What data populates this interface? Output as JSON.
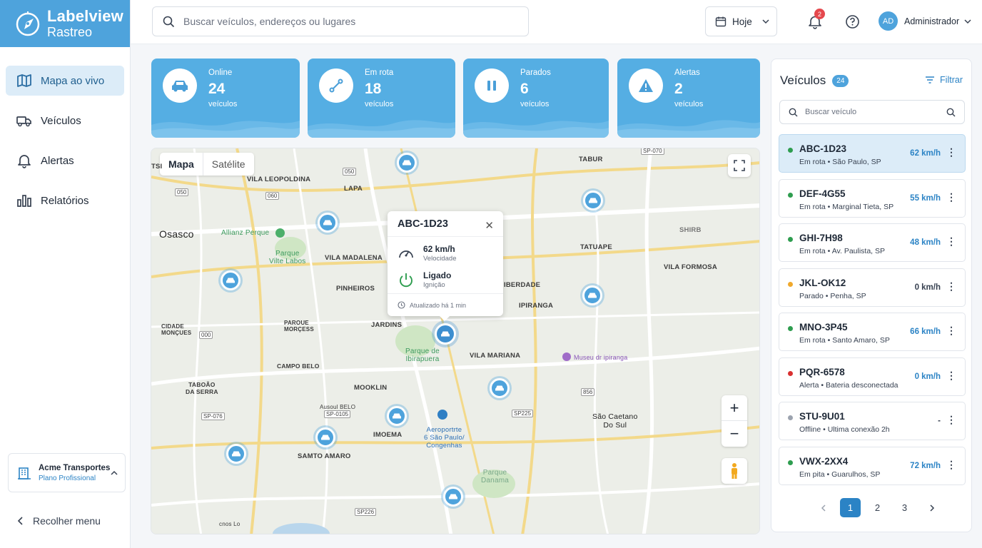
{
  "brand": {
    "line1": "Labelview",
    "line2": "Rastreo",
    "color": "#4ea3dc"
  },
  "nav": [
    {
      "label": "Mapa ao vivo",
      "icon": "map-icon"
    },
    {
      "label": "Veículos",
      "icon": "truck-icon"
    },
    {
      "label": "Alertas",
      "icon": "bell-icon"
    },
    {
      "label": "Relatórios",
      "icon": "bar-chart-icon"
    }
  ],
  "org": {
    "name": "Acme Transportes",
    "plan": "Plano Profissional"
  },
  "collapse_label": "Recolher menu",
  "topbar": {
    "search_placeholder": "Buscar veículos, endereços ou lugares",
    "date_label": "Hoje",
    "notif_count": "2",
    "user_initials": "AD",
    "user_name": "Administrador"
  },
  "stats": [
    {
      "label": "Online",
      "value": "24",
      "unit": "veículos",
      "icon": "car-icon"
    },
    {
      "label": "Em rota",
      "value": "18",
      "unit": "veículos",
      "icon": "route-icon"
    },
    {
      "label": "Parados",
      "value": "6",
      "unit": "veículos",
      "icon": "pause-icon"
    },
    {
      "label": "Alertas",
      "value": "2",
      "unit": "veículos",
      "icon": "warning-icon"
    }
  ],
  "map": {
    "tabs": [
      "Mapa",
      "Satélite"
    ],
    "labels": {
      "osasco": "Osasco",
      "vila_leopoldina": "VILA LEOPOLDINA",
      "lapa": "LAPA",
      "tabur": "TABUR",
      "allianz": "Allianz Perque",
      "parque_vilte": "Parque\nVilte Labos",
      "vila_madalena": "VILA MADALENA",
      "tatuape": "TATUAPE",
      "vila_formosa": "VILA FORMOSA",
      "pinheiros": "PINHEIROS",
      "liberdade": "IBERDADE",
      "ipiranga": "IPIRANGA",
      "cidade_moncoes": "CIDADE\nMONÇUES",
      "parque_morcess": "PAROUE\nMORÇESS",
      "jardins": "JARDINS",
      "ibirapuera": "Parque de\nIbirapuera",
      "vila_mariana": "VILA MARIANA",
      "museu": "Museu dr ipiranga",
      "campo_belo": "CAMPO BELO",
      "taboao": "TABOÃO\nDA SERRA",
      "mooklin": "MOOKLIN",
      "ausoul": "Ausoul BELO",
      "imoema": "IMOEMA",
      "aeroporto": "Aeroportrte\n6 São Paulo/\nCongenhas",
      "sao_caetano": "São Caetano\nDo Sul",
      "santo_amaro": "SAMTO AMARO",
      "parque_danama": "Parque\nDanama",
      "shirb": "SHIRB",
      "cnos": "cnos Lo",
      "tsi": "TSI"
    },
    "road_shields": [
      "SP-070",
      "050",
      "050",
      "060",
      "000",
      "856",
      "SP225",
      "SP-076",
      "SP-0105",
      "SP226"
    ],
    "popup": {
      "plate": "ABC-1D23",
      "speed": "62 km/h",
      "speed_label": "Velocidade",
      "ignition": "Ligado",
      "ignition_label": "Ignição",
      "updated": "Atualizado há 1 min"
    }
  },
  "panel": {
    "title": "Veículos",
    "count": "24",
    "filter_label": "Filtrar",
    "search_placeholder": "Buscar veículo",
    "vehicles": [
      {
        "plate": "ABC-1D23",
        "status": "Em rota",
        "location": "São Paulo, SP",
        "speed": "62 km/h",
        "dot": "#2e9d4f",
        "speed_color": "#2b83c5"
      },
      {
        "plate": "DEF-4G55",
        "status": "Em rota",
        "location": "Marginal Tieta, SP",
        "speed": "55 km/h",
        "dot": "#2e9d4f",
        "speed_color": "#2b83c5"
      },
      {
        "plate": "GHI-7H98",
        "status": "Em rota",
        "location": "Av. Paulista, SP",
        "speed": "48 km/h",
        "dot": "#2e9d4f",
        "speed_color": "#2b83c5"
      },
      {
        "plate": "JKL-OK12",
        "status": "Parado",
        "location": "Penha, SP",
        "speed": "0 km/h",
        "dot": "#f0a92c",
        "speed_color": "#374151"
      },
      {
        "plate": "MNO-3P45",
        "status": "Em rota",
        "location": "Santo Amaro, SP",
        "speed": "66 km/h",
        "dot": "#2e9d4f",
        "speed_color": "#2b83c5"
      },
      {
        "plate": "PQR-6578",
        "status": "Alerta",
        "location": "Bateria desconectada",
        "speed": "0 km/h",
        "dot": "#d93030",
        "speed_color": "#2b83c5"
      },
      {
        "plate": "STU-9U01",
        "status": "Offline",
        "location": "Ultima conexão 2h",
        "speed": "-",
        "dot": "#9ca3af",
        "speed_color": "#374151"
      },
      {
        "plate": "VWX-2XX4",
        "status": "Em pita",
        "location": "Guarulhos, SP",
        "speed": "72 km/h",
        "dot": "#2e9d4f",
        "speed_color": "#2b83c5"
      }
    ],
    "pages": [
      "1",
      "2",
      "3"
    ],
    "current_page": "1"
  }
}
